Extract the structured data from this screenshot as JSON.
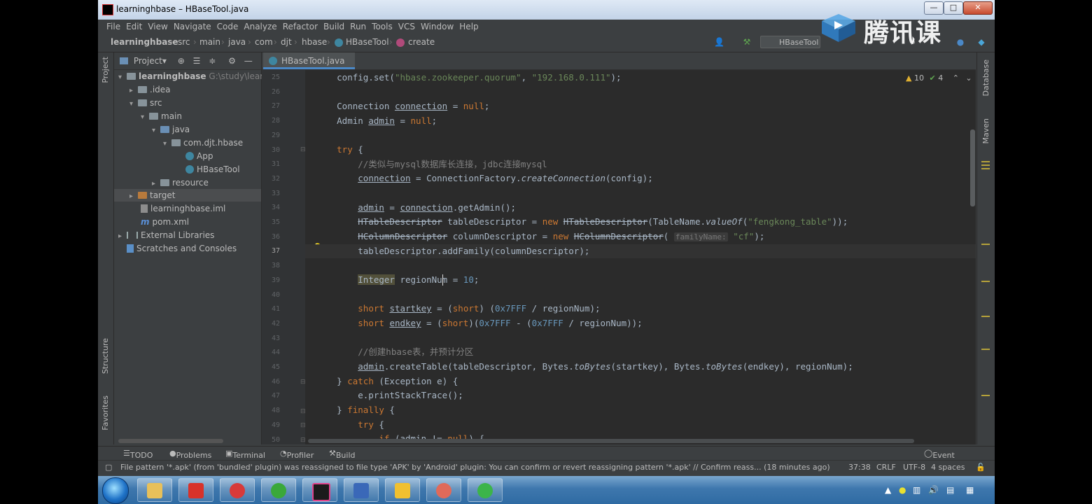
{
  "window": {
    "title": "learninghbase – HBaseTool.java",
    "min_label": "—",
    "max_label": "□",
    "close_label": "✕"
  },
  "menu": [
    "File",
    "Edit",
    "View",
    "Navigate",
    "Code",
    "Analyze",
    "Refactor",
    "Build",
    "Run",
    "Tools",
    "VCS",
    "Window",
    "Help"
  ],
  "breadcrumb": [
    "learninghbase",
    "src",
    "main",
    "java",
    "com",
    "djt",
    "hbase",
    "HBaseTool",
    "create"
  ],
  "run_config": "HBaseTool",
  "watermark": "腾讯课堂",
  "left_strip": {
    "project": "Project",
    "structure": "Structure",
    "favorites": "Favorites"
  },
  "project_panel": {
    "title": "Project▾",
    "tree": [
      {
        "label": "learninghbase",
        "hint": "G:\\study\\learni",
        "depth": 0,
        "arrow": "▾",
        "icon": "folder"
      },
      {
        "label": ".idea",
        "depth": 1,
        "arrow": "▸",
        "icon": "folder"
      },
      {
        "label": "src",
        "depth": 1,
        "arrow": "▾",
        "icon": "folder"
      },
      {
        "label": "main",
        "depth": 2,
        "arrow": "▾",
        "icon": "folder"
      },
      {
        "label": "java",
        "depth": 3,
        "arrow": "▾",
        "icon": "folder-src"
      },
      {
        "label": "com.djt.hbase",
        "depth": 4,
        "arrow": "▾",
        "icon": "folder"
      },
      {
        "label": "App",
        "depth": 5,
        "arrow": "",
        "icon": "class"
      },
      {
        "label": "HBaseTool",
        "depth": 5,
        "arrow": "",
        "icon": "class"
      },
      {
        "label": "resource",
        "depth": 3,
        "arrow": "▸",
        "icon": "folder"
      },
      {
        "label": "target",
        "depth": 1,
        "arrow": "▸",
        "icon": "folder-orange"
      },
      {
        "label": "learninghbase.iml",
        "depth": 1,
        "arrow": "",
        "icon": "file"
      },
      {
        "label": "pom.xml",
        "depth": 1,
        "arrow": "",
        "icon": "maven"
      },
      {
        "label": "External Libraries",
        "depth": 0,
        "arrow": "▸",
        "icon": "library"
      },
      {
        "label": "Scratches and Consoles",
        "depth": 0,
        "arrow": "",
        "icon": "scratch"
      }
    ]
  },
  "editor": {
    "tab": "HBaseTool.java",
    "warnings": "10",
    "checks": "4",
    "current_line": 37,
    "line_numbers": [
      25,
      26,
      27,
      28,
      29,
      30,
      31,
      32,
      33,
      34,
      35,
      36,
      37,
      38,
      39,
      40,
      41,
      42,
      43,
      44,
      45,
      46,
      47,
      48,
      49,
      50
    ]
  },
  "right_strip": {
    "database": "Database",
    "maven": "Maven"
  },
  "bottom_tools": [
    "TODO",
    "Problems",
    "Terminal",
    "Profiler",
    "Build"
  ],
  "event_log": "Event Log",
  "status": {
    "message": "File pattern '*.apk' (from 'bundled' plugin) was reassigned to file type 'APK' by 'Android' plugin: You can confirm or revert reassigning pattern '*.apk' // Confirm reass... (18 minutes ago)",
    "position": "37:38",
    "line_sep": "CRLF",
    "encoding": "UTF-8",
    "indent": "4 spaces"
  },
  "colors": {
    "ide_bg": "#3c3f41",
    "editor_bg": "#2b2b2b",
    "keyword": "#cc7832",
    "string": "#6a8759",
    "number": "#6897bb",
    "comment": "#808080",
    "text": "#a9b7c6",
    "accent": "#4a88c7"
  }
}
